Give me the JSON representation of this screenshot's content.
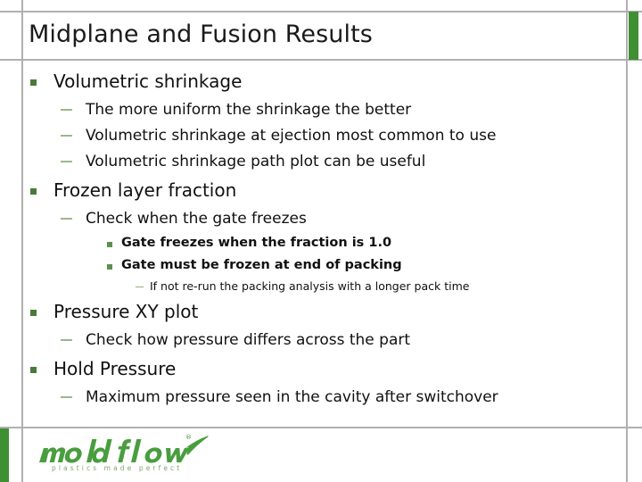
{
  "slide": {
    "title": "Midplane and Fusion Results",
    "accent_color": "#3f8f33",
    "rule_color": "#b0b0b0",
    "text_color": "#111111"
  },
  "content": [
    {
      "level": 1,
      "text": "Volumetric shrinkage",
      "bullet": "green-square-bullet"
    },
    {
      "level": 2,
      "text": "The more uniform the shrinkage the better",
      "bullet": "dash-bullet"
    },
    {
      "level": 2,
      "text": "Volumetric shrinkage at ejection most common to use",
      "bullet": "dash-bullet"
    },
    {
      "level": 2,
      "text": "Volumetric shrinkage path plot can be useful",
      "bullet": "dash-bullet"
    },
    {
      "level": 1,
      "text": "Frozen layer fraction",
      "bullet": "green-square-bullet"
    },
    {
      "level": 2,
      "text": "Check when the gate freezes",
      "bullet": "dash-bullet"
    },
    {
      "level": 3,
      "text": "Gate freezes when the fraction is 1.0",
      "bullet": "green-square-bullet"
    },
    {
      "level": 3,
      "text": "Gate must be frozen at end of packing",
      "bullet": "green-square-bullet"
    },
    {
      "level": 4,
      "text": "If not re-run the packing analysis with a longer pack time",
      "bullet": "dash-bullet"
    },
    {
      "level": 1,
      "text": "Pressure XY plot",
      "bullet": "green-square-bullet"
    },
    {
      "level": 2,
      "text": "Check how pressure differs across the part",
      "bullet": "dash-bullet"
    },
    {
      "level": 1,
      "text": "Hold Pressure",
      "bullet": "green-square-bullet"
    },
    {
      "level": 2,
      "text": "Maximum pressure seen in the cavity after switchover",
      "bullet": "dash-bullet"
    }
  ],
  "logo": {
    "wordmark": "moldflow",
    "tagline": "plastics made perfect",
    "registered_mark": "®",
    "color": "#4a9d3f"
  }
}
